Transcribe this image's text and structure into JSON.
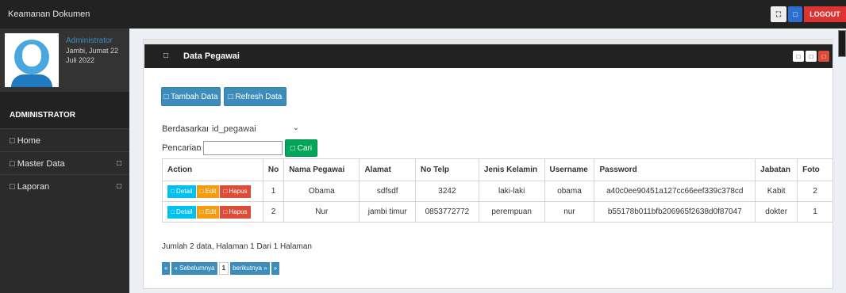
{
  "app": {
    "brand": "Keamanan Dokumen",
    "top_icons": {
      "grid_glyph": "⛶",
      "square_glyph": "□"
    },
    "logout_label": "LOGOUT"
  },
  "sidebar": {
    "user_name": "Administrator",
    "user_date": "Jambi, Jumat 22 Juli 2022",
    "role": "ADMINISTRATOR",
    "items": [
      {
        "label": "□ Home",
        "arrow": ""
      },
      {
        "label": "□ Master Data",
        "arrow": "□"
      },
      {
        "label": "□ Laporan",
        "arrow": "□"
      }
    ]
  },
  "panel": {
    "header_icon": "□",
    "title": "Data Pegawai",
    "tools": [
      "□",
      "□",
      "□"
    ]
  },
  "toolbar": {
    "add_label": "□ Tambah Data",
    "refresh_label": "□ Refresh Data"
  },
  "filter": {
    "by_label": "Berdasarkan:",
    "by_value": "id_pegawai",
    "search_label": "Pencarian",
    "search_colon": ":",
    "search_value": "",
    "search_button": "□ Cari"
  },
  "table": {
    "columns": [
      "Action",
      "No",
      "Nama Pegawai",
      "Alamat",
      "No Telp",
      "Jenis Kelamin",
      "Username",
      "Password",
      "Jabatan",
      "Foto"
    ],
    "row_buttons": {
      "detail": "□ Detail",
      "edit": "□ Edit",
      "delete": "□ Hapus"
    },
    "rows": [
      {
        "no": "1",
        "nama": "Obama",
        "alamat": "sdfsdf",
        "telp": "3242",
        "jk": "laki-laki",
        "username": "obama",
        "password": "a40c0ee90451a127cc66eef339c378cd",
        "jabatan": "Kabit",
        "foto": "2"
      },
      {
        "no": "2",
        "nama": "Nur",
        "alamat": "jambi timur",
        "telp": "0853772772",
        "jk": "perempuan",
        "username": "nur",
        "password": "b55178b011bfb206965f2638d0f87047",
        "jabatan": "dokter",
        "foto": "1"
      }
    ]
  },
  "summary": "Jumlah 2 data, Halaman 1 Dari 1 Halaman",
  "pagination": {
    "first": "«",
    "prev": "« Sebelumnya",
    "current": "1",
    "next": "berikutnya »",
    "last": "»"
  },
  "colors": {
    "topbar": "#222222",
    "primary": "#3c8dbc",
    "success": "#00a65a",
    "warning": "#f39c12",
    "danger": "#dd4b39",
    "info": "#00c0ef"
  }
}
